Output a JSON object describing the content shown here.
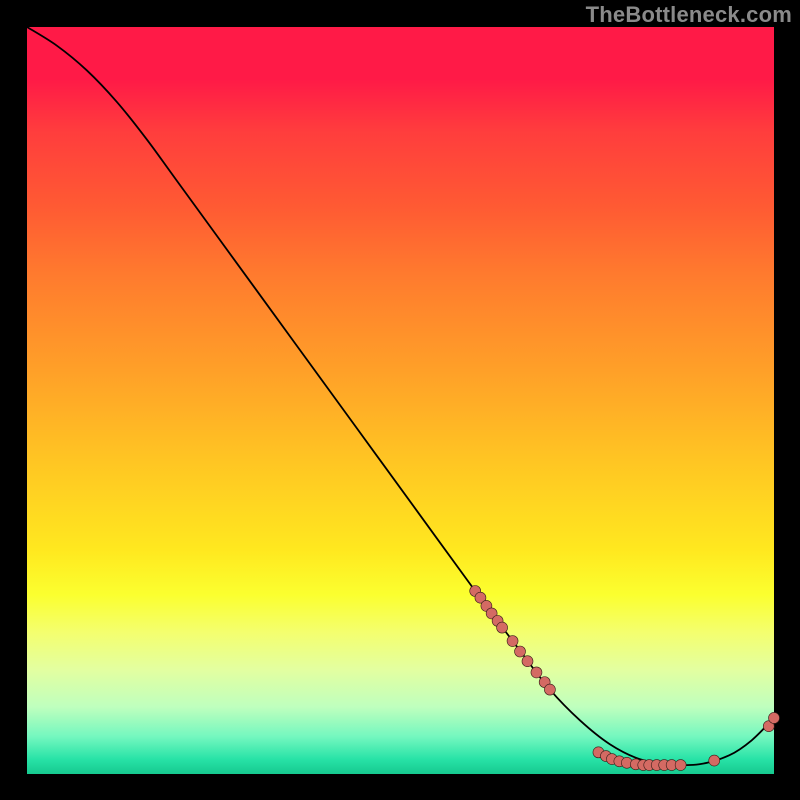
{
  "watermark": "TheBottleneck.com",
  "colors": {
    "curve": "#000000",
    "marker_fill": "#d46a63",
    "marker_stroke": "#3a1f1a"
  },
  "chart_data": {
    "type": "line",
    "title": "",
    "xlabel": "",
    "ylabel": "",
    "xlim": [
      0,
      100
    ],
    "ylim": [
      0,
      100
    ],
    "grid": false,
    "legend": false,
    "series": [
      {
        "name": "curve",
        "x": [
          0,
          4,
          8,
          12,
          16,
          20,
          28,
          36,
          44,
          52,
          60,
          66,
          70,
          74,
          78,
          82,
          86,
          90,
          94,
          97,
          100
        ],
        "y": [
          100,
          97.5,
          94.2,
          90.0,
          85.0,
          79.5,
          68.5,
          57.5,
          46.5,
          35.5,
          24.5,
          16.5,
          11.3,
          7.2,
          4.0,
          2.0,
          1.3,
          1.3,
          2.5,
          4.5,
          7.5
        ]
      }
    ],
    "markers": [
      {
        "x": 60.0,
        "y": 24.5
      },
      {
        "x": 60.7,
        "y": 23.6
      },
      {
        "x": 61.5,
        "y": 22.5
      },
      {
        "x": 62.2,
        "y": 21.5
      },
      {
        "x": 63.0,
        "y": 20.5
      },
      {
        "x": 63.6,
        "y": 19.6
      },
      {
        "x": 65.0,
        "y": 17.8
      },
      {
        "x": 66.0,
        "y": 16.4
      },
      {
        "x": 67.0,
        "y": 15.1
      },
      {
        "x": 68.2,
        "y": 13.6
      },
      {
        "x": 69.3,
        "y": 12.3
      },
      {
        "x": 70.0,
        "y": 11.3
      },
      {
        "x": 76.5,
        "y": 2.9
      },
      {
        "x": 77.5,
        "y": 2.4
      },
      {
        "x": 78.3,
        "y": 2.0
      },
      {
        "x": 79.3,
        "y": 1.7
      },
      {
        "x": 80.3,
        "y": 1.5
      },
      {
        "x": 81.5,
        "y": 1.3
      },
      {
        "x": 82.5,
        "y": 1.2
      },
      {
        "x": 83.3,
        "y": 1.2
      },
      {
        "x": 84.3,
        "y": 1.2
      },
      {
        "x": 85.3,
        "y": 1.2
      },
      {
        "x": 86.3,
        "y": 1.2
      },
      {
        "x": 87.5,
        "y": 1.2
      },
      {
        "x": 92.0,
        "y": 1.8
      },
      {
        "x": 99.3,
        "y": 6.4
      },
      {
        "x": 100.0,
        "y": 7.5
      }
    ]
  }
}
